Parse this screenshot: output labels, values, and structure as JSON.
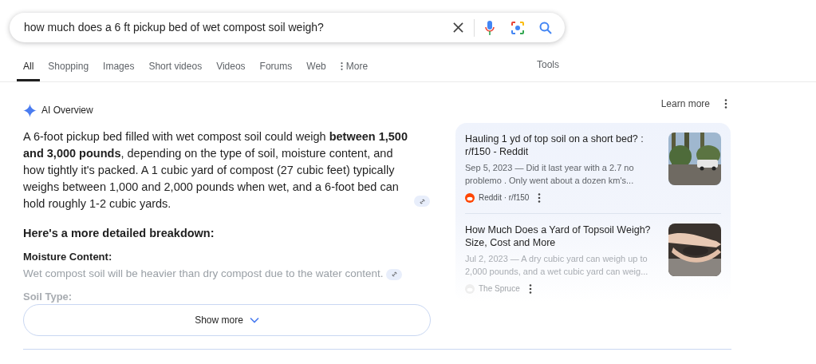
{
  "search": {
    "value": "how much does a 6 ft pickup bed of wet compost soil weigh?"
  },
  "tabs": [
    {
      "label": "All",
      "selected": true
    },
    {
      "label": "Shopping",
      "selected": false
    },
    {
      "label": "Images",
      "selected": false
    },
    {
      "label": "Short videos",
      "selected": false
    },
    {
      "label": "Videos",
      "selected": false
    },
    {
      "label": "Forums",
      "selected": false
    },
    {
      "label": "Web",
      "selected": false
    },
    {
      "label": "More",
      "selected": false,
      "kind": "menu"
    }
  ],
  "tools": "Tools",
  "overview": {
    "title": "AI Overview",
    "learn_more": "Learn more",
    "summary": "A 6-foot pickup bed filled with wet compost soil could weigh **between 1,500 and 3,000 pounds**, depending on the type of soil, moisture content, and how tightly it's packed. A 1 cubic yard of compost (27 cubic feet) typically weighs between 1,000 and 2,000 pounds when wet, and a 6-foot bed can hold roughly 1-2 cubic yards.",
    "heading": "Here's a more detailed breakdown:",
    "points": [
      {
        "title": "Moisture Content:",
        "text": "Wet compost soil will be heavier than dry compost due to the water content."
      },
      {
        "title": "Soil Type:"
      }
    ],
    "show_more": "Show more"
  },
  "sources": [
    {
      "title": "Hauling 1 yd of top soil on a short bed? : r/f150 - Reddit",
      "snippet": "Sep 5, 2023 — Did it last year with a 2.7 no problemo . Only went about a dozen km's...",
      "site": "Reddit · r/f150",
      "faded": false,
      "kind": "truck"
    },
    {
      "title": "How Much Does a Yard of Topsoil Weigh? Size, Cost and More",
      "snippet": "Jul 2, 2023 — A dry cubic yard can weigh up to 2,000 pounds, and a wet cubic yard can weig...",
      "site": "The Spruce",
      "faded": true,
      "kind": "hands"
    }
  ]
}
